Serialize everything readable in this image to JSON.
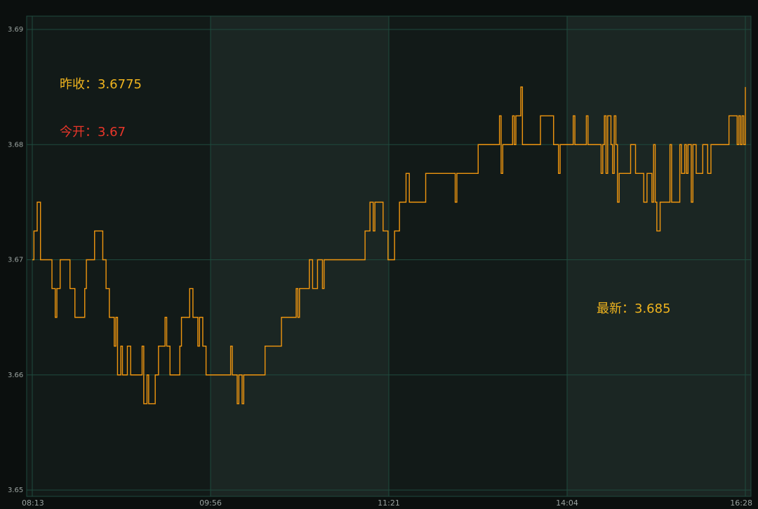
{
  "colors": {
    "background": "#0b0f0e",
    "panel_dark": "#121a18",
    "panel_light": "#1b2623",
    "grid": "#1f4a3e",
    "line": "#f0960f",
    "tick_text": "#9aa3a0",
    "label_gold": "#f0b41e",
    "label_red": "#e8362a"
  },
  "labels": {
    "prev_close": "昨收：3.6775",
    "open": "今开：3.67",
    "latest": "最新：3.685"
  },
  "chart_data": {
    "type": "line",
    "title": "",
    "xlabel": "",
    "ylabel": "",
    "ylim": [
      3.65,
      3.69
    ],
    "yticks": [
      3.65,
      3.66,
      3.67,
      3.68,
      3.69
    ],
    "ytick_labels": [
      "3.65",
      "3.66",
      "3.67",
      "3.68",
      "3.69"
    ],
    "xlim": [
      "08:13",
      "16:28"
    ],
    "xticks": [
      "08:13",
      "09:56",
      "11:21",
      "14:04",
      "16:28"
    ],
    "grid": true,
    "legend": "none",
    "series": [
      {
        "values": [
          3.67,
          3.6725,
          3.6725,
          3.675,
          3.675,
          3.67,
          3.67,
          3.67,
          3.67,
          3.67,
          3.67,
          3.67,
          3.6675,
          3.6675,
          3.665,
          3.6675,
          3.6675,
          3.67,
          3.67,
          3.67,
          3.67,
          3.67,
          3.67,
          3.6675,
          3.6675,
          3.6675,
          3.665,
          3.665,
          3.665,
          3.665,
          3.665,
          3.665,
          3.6675,
          3.67,
          3.67,
          3.67,
          3.67,
          3.67,
          3.6725,
          3.6725,
          3.6725,
          3.6725,
          3.6725,
          3.67,
          3.67,
          3.6675,
          3.6675,
          3.665,
          3.665,
          3.665,
          3.6625,
          3.665,
          3.66,
          3.66,
          3.6625,
          3.66,
          3.66,
          3.66,
          3.6625,
          3.6625,
          3.66,
          3.66,
          3.66,
          3.66,
          3.66,
          3.66,
          3.66,
          3.6625,
          3.6575,
          3.6575,
          3.66,
          3.6575,
          3.6575,
          3.6575,
          3.6575,
          3.66,
          3.66,
          3.6625,
          3.6625,
          3.6625,
          3.6625,
          3.665,
          3.6625,
          3.6625,
          3.66,
          3.66,
          3.66,
          3.66,
          3.66,
          3.66,
          3.6625,
          3.665,
          3.665,
          3.665,
          3.665,
          3.665,
          3.6675,
          3.6675,
          3.665,
          3.665,
          3.665,
          3.6625,
          3.665,
          3.665,
          3.6625,
          3.6625,
          3.66,
          3.66,
          3.66,
          3.66,
          3.66,
          3.66,
          3.66,
          3.66,
          3.66,
          3.66,
          3.66,
          3.66,
          3.66,
          3.66,
          3.66,
          3.6625,
          3.66,
          3.66,
          3.66,
          3.6575,
          3.66,
          3.66,
          3.6575,
          3.66,
          3.66,
          3.66,
          3.66,
          3.66,
          3.66,
          3.66,
          3.66,
          3.66,
          3.66,
          3.66,
          3.66,
          3.66,
          3.6625,
          3.6625,
          3.6625,
          3.6625,
          3.6625,
          3.6625,
          3.6625,
          3.6625,
          3.6625,
          3.6625,
          3.665,
          3.665,
          3.665,
          3.665,
          3.665,
          3.665,
          3.665,
          3.665,
          3.665,
          3.6675,
          3.665,
          3.6675,
          3.6675,
          3.6675,
          3.6675,
          3.6675,
          3.6675,
          3.67,
          3.67,
          3.6675,
          3.6675,
          3.6675,
          3.67,
          3.67,
          3.67,
          3.6675,
          3.67,
          3.67,
          3.67,
          3.67,
          3.67,
          3.67,
          3.67,
          3.67,
          3.67,
          3.67,
          3.67,
          3.67,
          3.67,
          3.67,
          3.67,
          3.67,
          3.67,
          3.67,
          3.67,
          3.67,
          3.67,
          3.67,
          3.67,
          3.67,
          3.67,
          3.6725,
          3.6725,
          3.6725,
          3.675,
          3.675,
          3.6725,
          3.675,
          3.675,
          3.675,
          3.675,
          3.675,
          3.6725,
          3.6725,
          3.6725,
          3.67,
          3.67,
          3.67,
          3.67,
          3.6725,
          3.6725,
          3.6725,
          3.675,
          3.675,
          3.675,
          3.675,
          3.6775,
          3.6775,
          3.675,
          3.675,
          3.675,
          3.675,
          3.675,
          3.675,
          3.675,
          3.675,
          3.675,
          3.675,
          3.6775,
          3.6775,
          3.6775,
          3.6775,
          3.6775,
          3.6775,
          3.6775,
          3.6775,
          3.6775,
          3.6775,
          3.6775,
          3.6775,
          3.6775,
          3.6775,
          3.6775,
          3.6775,
          3.6775,
          3.6775,
          3.675,
          3.6775,
          3.6775,
          3.6775,
          3.6775,
          3.6775,
          3.6775,
          3.6775,
          3.6775,
          3.6775,
          3.6775,
          3.6775,
          3.6775,
          3.6775,
          3.68,
          3.68,
          3.68,
          3.68,
          3.68,
          3.68,
          3.68,
          3.68,
          3.68,
          3.68,
          3.68,
          3.68,
          3.68,
          3.6825,
          3.6775,
          3.68,
          3.68,
          3.68,
          3.68,
          3.68,
          3.68,
          3.6825,
          3.68,
          3.6825,
          3.6825,
          3.6825,
          3.685,
          3.68,
          3.68,
          3.68,
          3.68,
          3.68,
          3.68,
          3.68,
          3.68,
          3.68,
          3.68,
          3.68,
          3.6825,
          3.6825,
          3.6825,
          3.6825,
          3.6825,
          3.6825,
          3.6825,
          3.6825,
          3.68,
          3.68,
          3.68,
          3.6775,
          3.68,
          3.68,
          3.68,
          3.68,
          3.68,
          3.68,
          3.68,
          3.68,
          3.6825,
          3.68,
          3.68,
          3.68,
          3.68,
          3.68,
          3.68,
          3.68,
          3.6825,
          3.68,
          3.68,
          3.68,
          3.68,
          3.68,
          3.68,
          3.68,
          3.68,
          3.6775,
          3.68,
          3.6825,
          3.6775,
          3.6825,
          3.6825,
          3.68,
          3.6775,
          3.6825,
          3.68,
          3.675,
          3.6775,
          3.6775,
          3.6775,
          3.6775,
          3.6775,
          3.6775,
          3.6775,
          3.68,
          3.68,
          3.68,
          3.6775,
          3.6775,
          3.6775,
          3.6775,
          3.6775,
          3.675,
          3.675,
          3.6775,
          3.6775,
          3.6775,
          3.675,
          3.68,
          3.675,
          3.6725,
          3.6725,
          3.675,
          3.675,
          3.675,
          3.675,
          3.675,
          3.675,
          3.68,
          3.675,
          3.675,
          3.675,
          3.675,
          3.675,
          3.68,
          3.6775,
          3.6775,
          3.68,
          3.6775,
          3.68,
          3.68,
          3.675,
          3.68,
          3.68,
          3.6775,
          3.6775,
          3.6775,
          3.6775,
          3.68,
          3.68,
          3.68,
          3.6775,
          3.6775,
          3.68,
          3.68,
          3.68,
          3.68,
          3.68,
          3.68,
          3.68,
          3.68,
          3.68,
          3.68,
          3.68,
          3.6825,
          3.6825,
          3.6825,
          3.6825,
          3.6825,
          3.68,
          3.6825,
          3.68,
          3.6825,
          3.68,
          3.685
        ]
      }
    ],
    "annotations": [
      {
        "key": "prev_close",
        "value": 3.6775
      },
      {
        "key": "open",
        "value": 3.67
      },
      {
        "key": "latest",
        "value": 3.685
      }
    ]
  }
}
